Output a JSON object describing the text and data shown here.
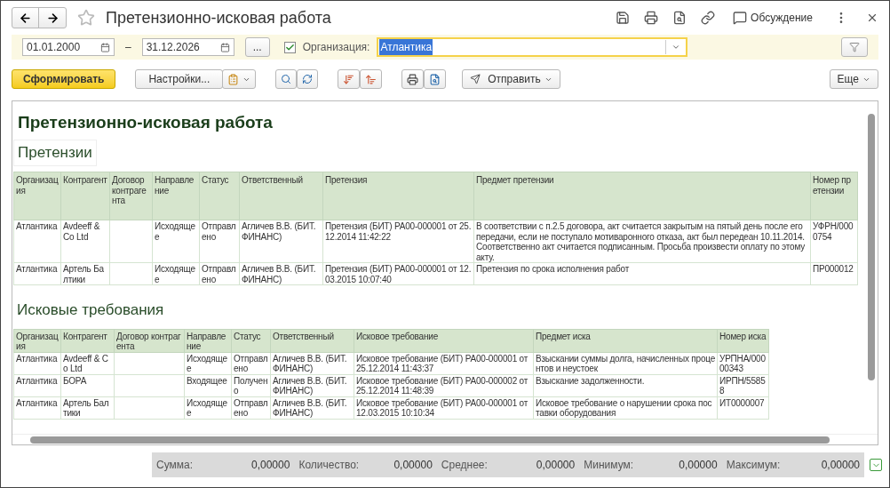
{
  "window": {
    "title": "Претензионно-исковая работа",
    "discussion": "Обсуждение"
  },
  "filter": {
    "date_from": "01.01.2000",
    "dash": "–",
    "date_to": "31.12.2026",
    "period_button": "...",
    "organization": {
      "checked": true,
      "label": "Организация:",
      "value": "Атлантика",
      "value_selected": true
    }
  },
  "toolbar": {
    "generate": "Сформировать",
    "settings": "Настройки...",
    "send": "Отправить",
    "more": "Еще"
  },
  "report": {
    "title": "Претензионно-исковая работа",
    "sections": [
      {
        "heading": "Претензии",
        "columns": [
          "Организация",
          "Контрагент",
          "Договор контрагента",
          "Направление",
          "Статус",
          "Ответственный",
          "Претензия",
          "Предмет претензии",
          "Номер претензии"
        ],
        "rows": [
          [
            "Атлантика",
            "Avdeeff & Co Ltd",
            "",
            "Исходящее",
            "Отправлено",
            "Агличев В.В. (БИТ.ФИНАНС)",
            "Претензия (БИТ) РА00-000001 от 25.12.2014 11:42:22",
            "В соответствии с п.2.5 договора, акт считается закрытым на пятый день после его передачи, если не поступало мотиваронного отказа, акт был передеан 10.11.2014. Соответственно акт считается подписанным. Просьба произвести оплату по этому акту.",
            "УФРН/0000754"
          ],
          [
            "Атлантика",
            "Артель Балтики",
            "",
            "Исходящее",
            "Отправлено",
            "Агличев В.В. (БИТ.ФИНАНС)",
            "Претензия (БИТ) РА00-000001 от 12.03.2015 10:07:40",
            "Претензия по срока исполнения работ",
            "ПР000012"
          ]
        ]
      },
      {
        "heading": "Исковые требования",
        "columns": [
          "Организация",
          "Контрагент",
          "Договор контрагента",
          "Направление",
          "Статус",
          "Ответственный",
          "Исковое требование",
          "Предмет иска",
          "Номер иска"
        ],
        "rows": [
          [
            "Атлантика",
            "Avdeeff & Co Ltd",
            "",
            "Исходящее",
            "Отправлено",
            "Агличев В.В. (БИТ.ФИНАНС)",
            "Исковое требование (БИТ) РА00-000001 от 25.12.2014 11:43:37",
            "Взыскании суммы долга, начисленных процентов и неустоек",
            "УРПНА/00000343"
          ],
          [
            "Атлантика",
            "БОРА",
            "",
            "Входящее",
            "Получено",
            "Агличев В.В. (БИТ.ФИНАНС)",
            "Исковое требование (БИТ) РА00-000002 от 25.12.2014 11:48:39",
            "Взыскание задолженности.",
            "ИРПН/55858"
          ],
          [
            "Атлантика",
            "Артель Балтики",
            "",
            "Исходящее",
            "Отправлено",
            "Агличев В.В. (БИТ.ФИНАНС)",
            "Исковое требование (БИТ) РА00-000001 от 12.03.2015 10:10:34",
            "Исковое требование о нарушении срока поставки оборудования",
            "ИТ0000007"
          ]
        ]
      }
    ]
  },
  "totals": [
    {
      "label": "Сумма:",
      "value": "0,00000"
    },
    {
      "label": "Количество:",
      "value": "0,00000"
    },
    {
      "label": "Среднее:",
      "value": "0,00000"
    },
    {
      "label": "Минимум:",
      "value": "0,00000"
    },
    {
      "label": "Максимум:",
      "value": "0,00000"
    }
  ]
}
